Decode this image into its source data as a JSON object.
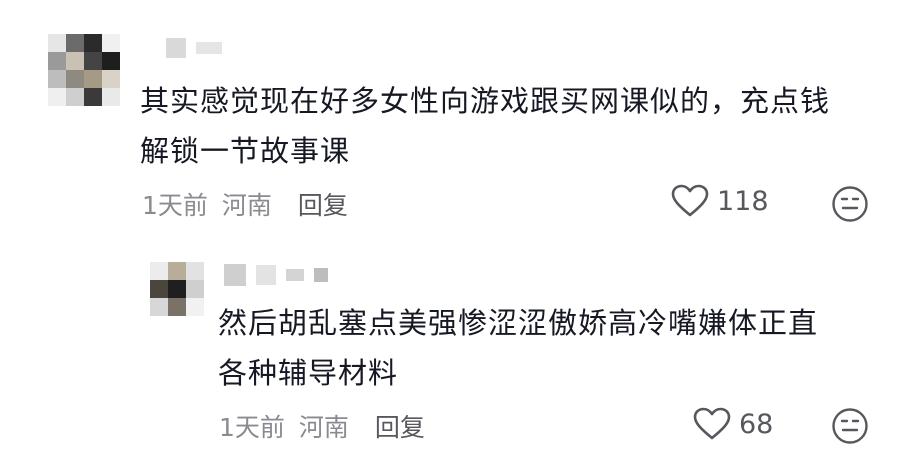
{
  "comments": [
    {
      "text_lines": [
        "其实感觉现在好多女性向游戏跟买网课似的，充点钱",
        "解锁一节故事课"
      ],
      "time": "1天前",
      "location": "河南",
      "reply_label": "回复",
      "like_count": "118",
      "icons": {
        "like": "heart-outline-icon",
        "dislike": "meh-face-icon"
      }
    }
  ],
  "replies": [
    {
      "text_lines": [
        "然后胡乱塞点美强惨涩涩傲娇高冷嘴嫌体正直",
        "各种辅导材料"
      ],
      "time": "1天前",
      "location": "河南",
      "reply_label": "回复",
      "like_count": "68",
      "icons": {
        "like": "heart-outline-icon",
        "dislike": "meh-face-icon"
      }
    }
  ]
}
